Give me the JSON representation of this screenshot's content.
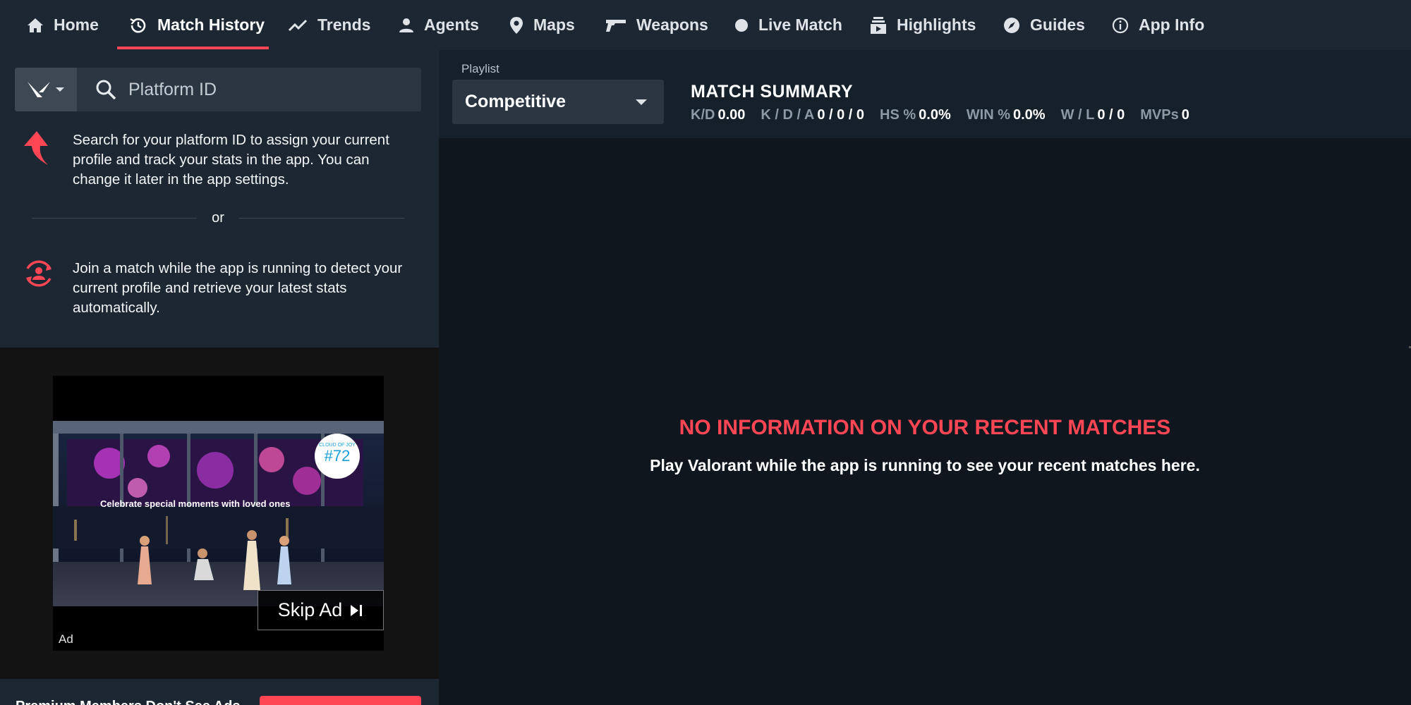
{
  "nav": {
    "items": [
      {
        "label": "Home",
        "icon": "home-icon"
      },
      {
        "label": "Match History",
        "icon": "history-icon",
        "active": true
      },
      {
        "label": "Trends",
        "icon": "trend-icon"
      },
      {
        "label": "Agents",
        "icon": "agent-icon"
      },
      {
        "label": "Maps",
        "icon": "map-pin-icon"
      },
      {
        "label": "Weapons",
        "icon": "gun-icon"
      },
      {
        "label": "Live Match",
        "icon": "live-dot-icon"
      },
      {
        "label": "Highlights",
        "icon": "highlights-icon"
      },
      {
        "label": "Guides",
        "icon": "compass-icon"
      },
      {
        "label": "App Info",
        "icon": "info-icon"
      }
    ],
    "accent": "#ff4655"
  },
  "sidebar": {
    "search": {
      "placeholder": "Platform ID"
    },
    "instruction_search": "Search for your platform ID to assign your current profile and track your stats in the app. You can change it later in the app settings.",
    "divider_text": "or",
    "instruction_join": "Join a match while the app is running to detect your current profile and retrieve your latest stats automatically."
  },
  "ad": {
    "banner_text": "Celebrate special moments with loved ones",
    "badge_top": "Cloud of Joy",
    "badge_number": "#72",
    "skip_label": "Skip Ad",
    "ad_label": "Ad"
  },
  "premium": {
    "text": "Premium Members Don't See Ads"
  },
  "main": {
    "playlist_label": "Playlist",
    "playlist_value": "Competitive",
    "summary_title": "MATCH SUMMARY",
    "stats": [
      {
        "label": "K/D",
        "value": "0.00"
      },
      {
        "label": "K / D / A",
        "value": "0 / 0 / 0"
      },
      {
        "label": "HS %",
        "value": "0.0%"
      },
      {
        "label": "WIN %",
        "value": "0.0%"
      },
      {
        "label": "W / L",
        "value": "0 / 0"
      },
      {
        "label": "MVPs",
        "value": "0"
      }
    ],
    "empty_title": "NO INFORMATION ON YOUR RECENT MATCHES",
    "empty_subtitle": "Play Valorant while the app is running to see your recent matches here."
  }
}
